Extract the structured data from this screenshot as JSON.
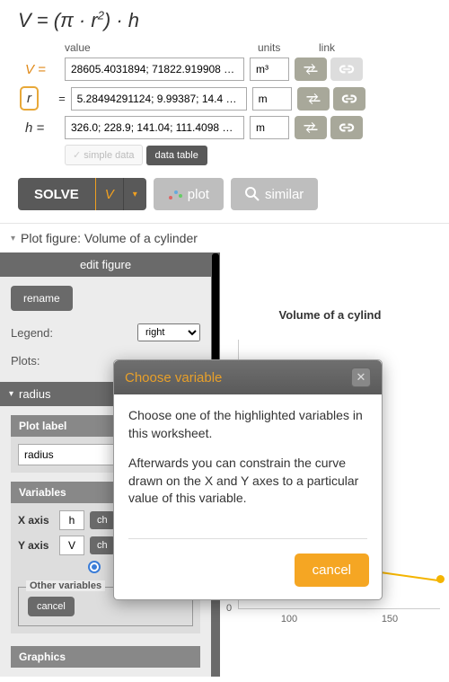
{
  "formula_html": "V = (π · r<sup>2</sup>) · h",
  "col_headers": {
    "value": "value",
    "units": "units",
    "link": "link"
  },
  "vars": {
    "V": {
      "label": "V =",
      "value": "28605.4031894; 71822.919908 …",
      "unit": "m³"
    },
    "r": {
      "label": "r =",
      "value": "5.28494291124; 9.99387; 14.4 …",
      "unit": "m"
    },
    "h": {
      "label": "h =",
      "value": "326.0; 228.9; 141.04; 111.4098 …",
      "unit": "m"
    }
  },
  "data_toggle": {
    "simple": "simple data",
    "table": "data table"
  },
  "actions": {
    "solve": "SOLVE",
    "solve_for": "V",
    "plot": "plot",
    "similar": "similar"
  },
  "plot_section_title": "Plot figure: Volume of a cylinder",
  "panel": {
    "title": "edit figure",
    "rename": "rename",
    "legend_label": "Legend:",
    "legend_value": "right",
    "plots_label": "Plots:",
    "radius": "radius",
    "plot_label_header": "Plot label",
    "plot_label_value": "radius",
    "variables_header": "Variables",
    "x_label": "X axis",
    "x_value": "h",
    "change": "change",
    "y_label": "Y axis",
    "y_value": "V",
    "other_vars": "Other variables",
    "cancel": "cancel",
    "graphics": "Graphics"
  },
  "chart_data": {
    "type": "line",
    "title": "Volume of a cylind",
    "x_ticks": [
      "100",
      "150"
    ],
    "y0": "0",
    "series": [
      {
        "name": "radius",
        "partial": true
      }
    ]
  },
  "modal": {
    "title": "Choose variable",
    "p1": "Choose one of the highlighted variables in this worksheet.",
    "p2": "Afterwards you can constrain the curve drawn on the X and Y axes to a particular value of this variable.",
    "cancel": "cancel"
  }
}
